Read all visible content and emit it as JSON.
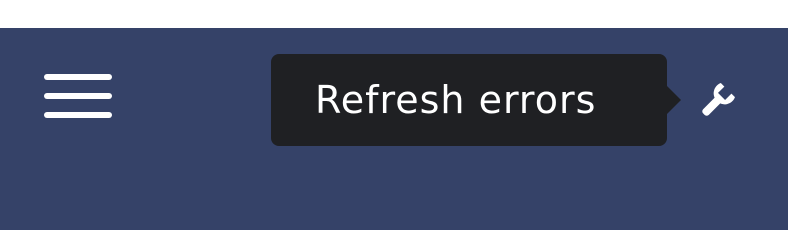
{
  "toolbar": {
    "background": "#354268",
    "menu_icon": "hamburger-menu-icon",
    "refresh_icon": "refresh-icon",
    "settings_icon": "wrench-icon"
  },
  "tooltip": {
    "text": "Refresh errors",
    "background": "#1f2023"
  }
}
